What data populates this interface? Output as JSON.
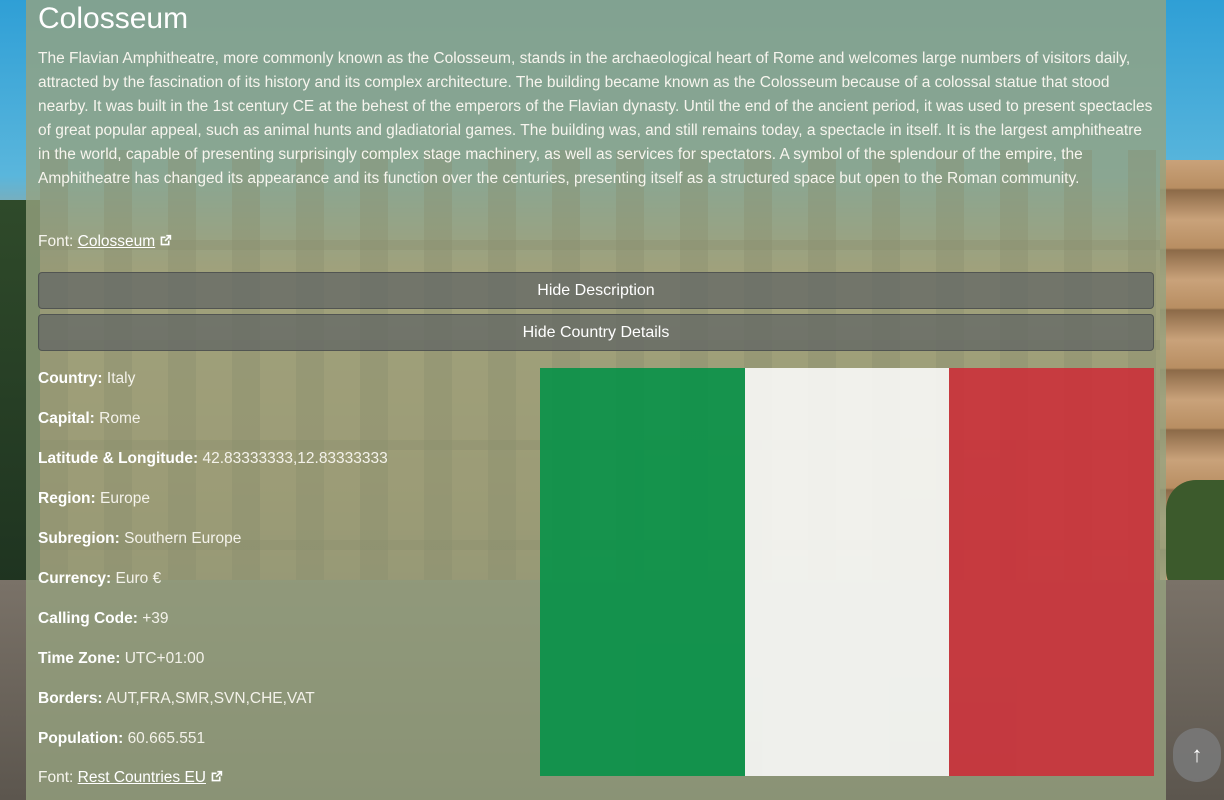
{
  "landmark": {
    "title": "Colosseum",
    "description": "The Flavian Amphitheatre, more commonly known as the Colosseum, stands in the archaeological heart of Rome and welcomes large numbers of visitors daily, attracted by the fascination of its history and its complex architecture. The building became known as the Colosseum because of a colossal statue that stood nearby. It was built in the 1st century CE at the behest of the emperors of the Flavian dynasty. Until the end of the ancient period, it was used to present spectacles of great popular appeal, such as animal hunts and gladiatorial games. The building was, and still remains today, a spectacle in itself. It is the largest amphitheatre in the world, capable of presenting surprisingly complex stage machinery, as well as services for spectators. A symbol of the splendour of the empire, the Amphitheatre has changed its appearance and its function over the centuries, presenting itself as a structured space but open to the Roman community.",
    "source_label": "Font:",
    "source_link": "Colosseum"
  },
  "buttons": {
    "hide_description": "Hide Description",
    "hide_country_details": "Hide Country Details"
  },
  "country": {
    "rows": [
      {
        "label": "Country:",
        "value": "Italy"
      },
      {
        "label": "Capital:",
        "value": "Rome"
      },
      {
        "label": "Latitude & Longitude:",
        "value": "42.83333333,12.83333333"
      },
      {
        "label": "Region:",
        "value": "Europe"
      },
      {
        "label": "Subregion:",
        "value": "Southern Europe"
      },
      {
        "label": "Currency:",
        "value": "Euro €"
      },
      {
        "label": "Calling Code:",
        "value": "+39"
      },
      {
        "label": "Time Zone:",
        "value": "UTC+01:00"
      },
      {
        "label": "Borders:",
        "value": "AUT,FRA,SMR,SVN,CHE,VAT"
      },
      {
        "label": "Population:",
        "value": "60.665.551"
      }
    ],
    "source_label": "Font:",
    "source_link": "Rest Countries EU",
    "flag_colors": [
      "#009246",
      "#ffffff",
      "#ce2b37"
    ]
  },
  "scroll_top": {
    "icon": "arrow-up-icon",
    "glyph": "↑"
  }
}
